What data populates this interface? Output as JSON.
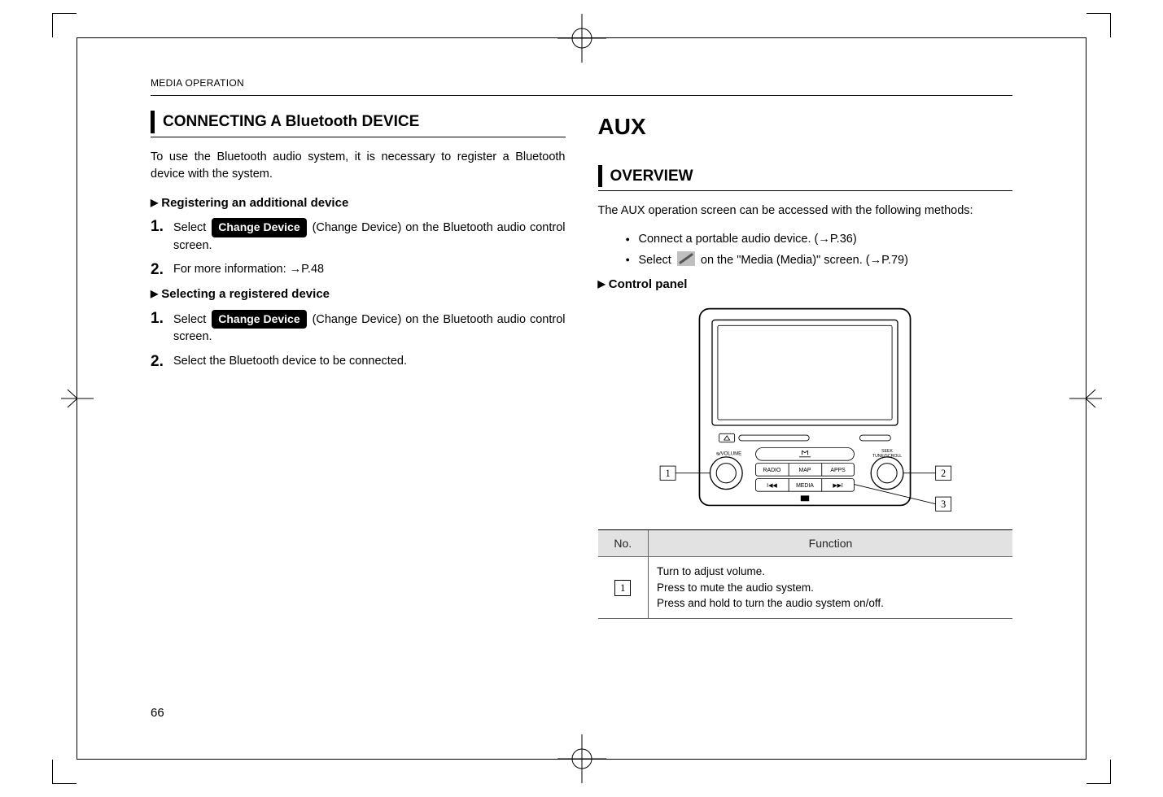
{
  "header": {
    "section": "MEDIA OPERATION"
  },
  "page_number": "66",
  "left": {
    "heading": "CONNECTING A Bluetooth DEVICE",
    "intro": "To use the Bluetooth audio system, it is necessary to register a Bluetooth device with the system.",
    "sub1": "Registering an additional device",
    "s1_1_a": "Select",
    "s1_1_btn": "Change Device",
    "s1_1_b": "(Change Device) on the Bluetooth audio control screen.",
    "s1_2": "For more information: →P.48",
    "sub2": "Selecting a registered device",
    "s2_1_a": "Select",
    "s2_1_btn": "Change Device",
    "s2_1_b": "(Change Device) on the Bluetooth audio control screen.",
    "s2_2": "Select the Bluetooth device to be connected."
  },
  "right": {
    "title": "AUX",
    "heading": "OVERVIEW",
    "intro": "The AUX operation screen can be accessed with the following methods:",
    "b1": "Connect a portable audio device. (→P.36)",
    "b2_a": "Select",
    "b2_b": "on the \"Media (Media)\" screen. (→P.79)",
    "sub": "Control panel",
    "table": {
      "h1": "No.",
      "h2": "Function",
      "r1_no": "1",
      "r1_l1": "Turn to adjust volume.",
      "r1_l2": "Press to mute the audio system.",
      "r1_l3": "Press and hold to turn the audio system on/off."
    },
    "panel_labels": {
      "n1": "1",
      "n2": "2",
      "n3": "3",
      "radio": "RADIO",
      "map": "MAP",
      "apps": "APPS",
      "media": "MEDIA",
      "vol": "ᴓ/VOLUME",
      "tune": "TUNE/SCROLL"
    }
  }
}
